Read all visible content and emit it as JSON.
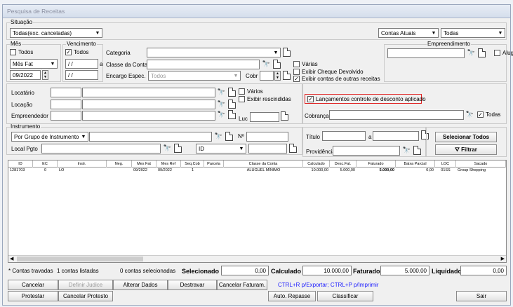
{
  "window": {
    "title": "Pesquisa de Receitas"
  },
  "situacao": {
    "legend": "Situação",
    "value": "Todas(exc. canceladas)",
    "contas_select": "Contas Atuais",
    "todas_select": "Todas"
  },
  "mes": {
    "legend": "Mês",
    "todos_label": "Todos",
    "tipo_select": "Mês Fat",
    "mes_value": "09/2022"
  },
  "vencimento": {
    "legend": "Vencimento",
    "todos_label": "Todos",
    "from_value": "/ /",
    "sep": "a",
    "to_value": "/ /"
  },
  "filters": {
    "categoria_label": "Categoria",
    "classe_label": "Classe da Conta",
    "encargo_label": "Encargo Espec.",
    "encargo_value": "Todos",
    "cobr_label": "Cobr",
    "varias_label": "Várias",
    "cheque_label": "Exibir Cheque Devolvido",
    "outras_label": "Exibir contas de outras receitas"
  },
  "empreendimento": {
    "legend": "Empreendimento",
    "aluguel_label": "Aluguel"
  },
  "locatario": {
    "locatario_label": "Locatário",
    "locacao_label": "Locação",
    "empreendedor_label": "Empreendedor",
    "varios_label": "Vários",
    "rescindidas_label": "Exibir rescindidas",
    "luc_label": "Luc"
  },
  "desconto": {
    "label": "Lançamentos controle de desconto aplicado"
  },
  "cobranca": {
    "label": "Cobrança",
    "todas_label": "Todas"
  },
  "instrumento": {
    "legend": "Instrumento",
    "select_value": "Por Grupo de Instrumento",
    "nro_label": "Nº",
    "local_label": "Local Pgto",
    "id_select": "ID"
  },
  "titulo": {
    "label": "Título",
    "sep": "a",
    "providencia_label": "Providência"
  },
  "buttons": {
    "selecionar_todos": "Selecionar Todos",
    "filtrar": "Filtrar",
    "cancelar": "Cancelar",
    "definir_judice": "Definir Judice",
    "alterar_dados": "Alterar Dados",
    "destravar": "Destravar",
    "cancelar_faturam": "Cancelar Faturam.",
    "protestar": "Protestar",
    "cancelar_protesto": "Cancelar Protesto",
    "auto_repasse": "Auto. Repasse",
    "classificar": "Classificar",
    "sair": "Sair"
  },
  "hint": "CTRL+R p/Exportar; CTRL+P p/Imprimir",
  "grid": {
    "columns": [
      "ID",
      "EC",
      "Instr.",
      "Neg.",
      "Mes Fat",
      "Mes Ref",
      "Seq.Cob",
      "Parcela",
      "Classe da Conta",
      "Calculado",
      "Desc.Fat.",
      "Faturado",
      "Baixa Parcial",
      "LOC",
      "Sacado"
    ],
    "rows": [
      [
        "1281703",
        "0",
        "LO",
        "",
        "09/2022",
        "09/2022",
        "1",
        "",
        "ALUGUEL MÍNIMO",
        "10.000,00",
        "5.000,00",
        "5.000,00",
        "0,00",
        "01SS",
        "Group Shopping"
      ]
    ]
  },
  "summary": {
    "travadas": "* Contas travadas",
    "listadas": "1 contas listadas",
    "selecionadas": "0 contas selecionadas",
    "selecionado_label": "Selecionado",
    "selecionado_value": "0,00",
    "calculado_label": "Calculado",
    "calculado_value": "10.000,00",
    "faturado_label": "Faturado",
    "faturado_value": "5.000,00",
    "liquidado_label": "Liquidado",
    "liquidado_value": "0,00"
  },
  "colors": {
    "hint": "#1a1aff",
    "highlight": "#e02020"
  }
}
